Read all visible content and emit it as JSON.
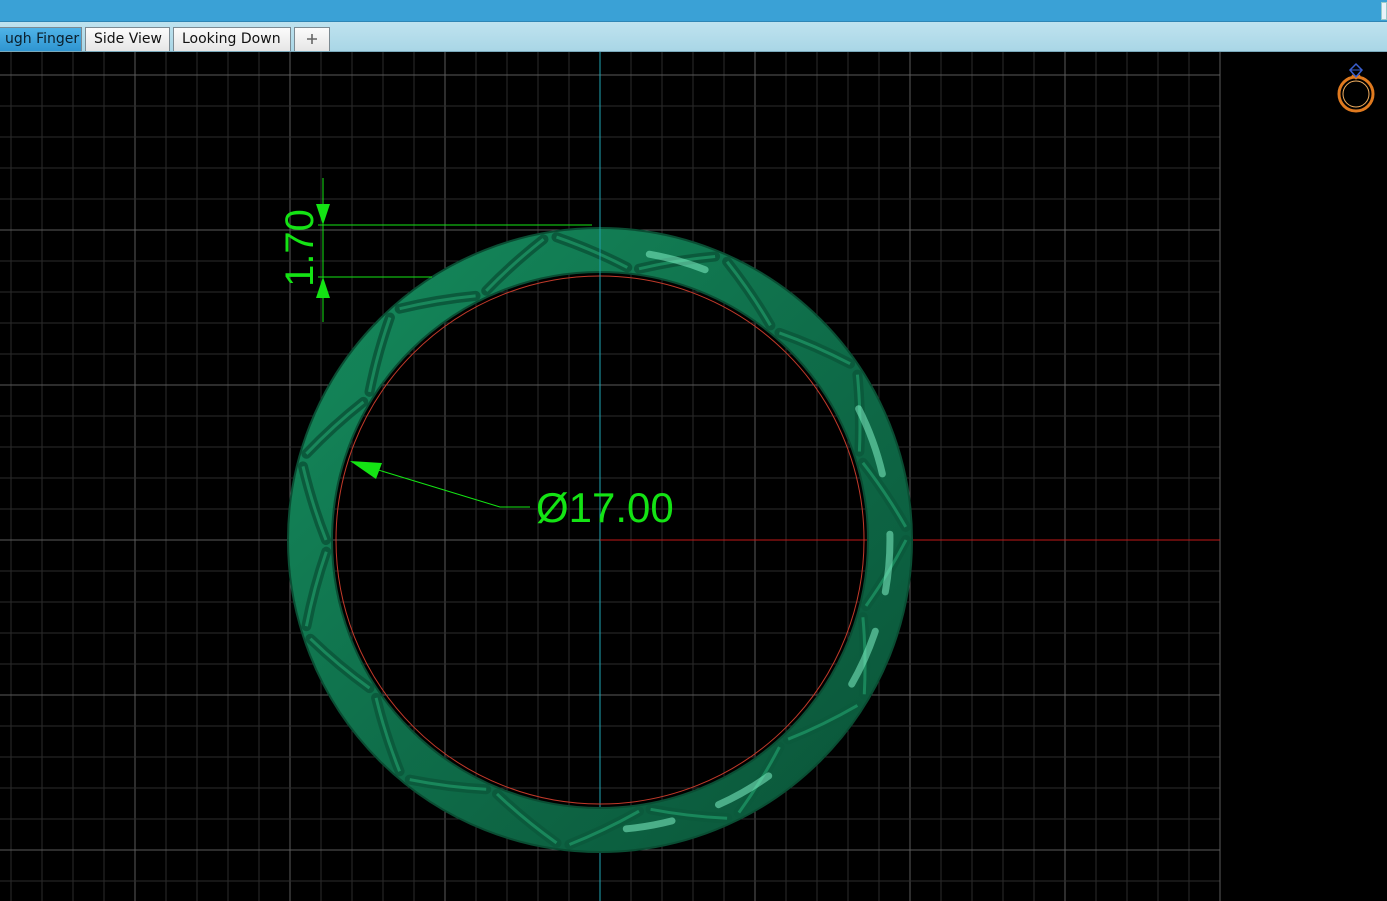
{
  "tabs": [
    {
      "label": "ugh Finger",
      "active": true
    },
    {
      "label": "Side View",
      "active": false
    },
    {
      "label": "Looking Down",
      "active": false
    },
    {
      "label": "+",
      "active": false
    }
  ],
  "dimensions": {
    "thickness_label": "1.70",
    "diameter_label": "Ø17.00"
  },
  "colors": {
    "dimension": "#14e314",
    "grid": "#5a5a5a",
    "axis_y": "#1fa6b4",
    "axis_x": "#c01818",
    "ring": "#0f6e4a",
    "inner_circle": "#c23a2a",
    "view_cube": "#e07a1f",
    "gem": "#3a5fd0"
  },
  "icons": {
    "view_cube": "ring-icon"
  }
}
